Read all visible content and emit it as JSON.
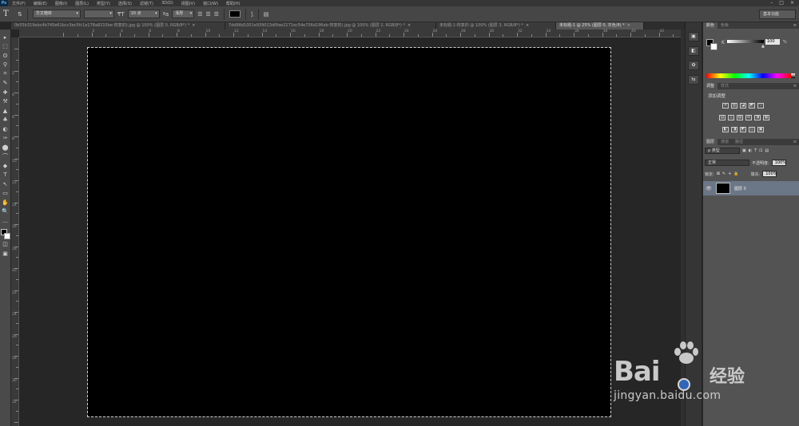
{
  "app": {
    "logo_text": "Ps"
  },
  "menu": [
    "文件(F)",
    "编辑(E)",
    "图像(I)",
    "图层(L)",
    "类型(Y)",
    "选择(S)",
    "滤镜(T)",
    "3D(D)",
    "视图(V)",
    "窗口(W)",
    "帮助(H)"
  ],
  "window_controls": [
    "–",
    "□",
    "×"
  ],
  "options": {
    "tool_glyph": "T",
    "font_family": "华文楷体",
    "font_style": "",
    "font_size": "10 点",
    "aa_glyph": "ªa",
    "antialias": "浑厚",
    "workspace": "基本功能"
  },
  "tabs": [
    {
      "label": "0b55b319ebc4b745e61bcc3ec5fc1e178a8215be-恢复的).jpg @ 100% (图层 0, RGB/8*) *",
      "active": false
    },
    {
      "label": "7dd98d1001e939013d0fee2171ec54e736d196eb-恢复的).jpg @ 100% (图层 2, RGB/8*) *",
      "active": false
    },
    {
      "label": "未标题-1-恢复的 @ 100% (图层 3, RGB/8*) *",
      "active": false
    },
    {
      "label": "未标题-1 @ 25% (图层 0, 灰色/8) *",
      "active": true
    }
  ],
  "tab_close": "×",
  "ruler": {
    "h_labels": [
      "2",
      "4",
      "6",
      "8",
      "10",
      "12",
      "14",
      "16",
      "18",
      "20",
      "22",
      "24",
      "26",
      "28",
      "30",
      "32",
      "34",
      "36",
      "38",
      "40",
      "42",
      "44",
      "46"
    ],
    "v_labels": [
      "2",
      "4",
      "6",
      "8",
      "10",
      "12",
      "14",
      "16",
      "18",
      "20",
      "22",
      "24",
      "26",
      "28",
      "30",
      "32",
      "34"
    ]
  },
  "tools": [
    "▸",
    "⬚",
    "ʘ",
    "⚲",
    "⌗",
    "✎",
    "✚",
    "⚒",
    "▲",
    "♣",
    "◐",
    "✑",
    "⬤",
    "⌒",
    "◆",
    "T",
    "↖",
    "▭",
    "✋",
    "🔍"
  ],
  "color_panel": {
    "tabs": [
      "颜色",
      "色板"
    ],
    "k_label": "K",
    "k_value": "100",
    "pct": "%",
    "menu_glyph": "≡"
  },
  "adjust_panel": {
    "tabs": [
      "调整",
      "样式"
    ],
    "title": "添加调整",
    "row1": [
      "☀",
      "▥",
      "◪",
      "◩",
      "▽"
    ],
    "row2": [
      "▤",
      "◬",
      "▧",
      "⚖",
      "◑",
      "▦"
    ],
    "row3": [
      "◧",
      "◨",
      "◩",
      "◫",
      "▣"
    ]
  },
  "layers_panel": {
    "tabs": [
      "图层",
      "通道",
      "路径"
    ],
    "filter_kind": "ρ 类型",
    "filter_icons": [
      "▣",
      "◐",
      "T",
      "⊡",
      "▤"
    ],
    "blend_mode": "正常",
    "opacity_label": "不透明度:",
    "opacity_value": "100%",
    "lock_label": "锁定:",
    "lock_icons": [
      "⊠",
      "✎",
      "✛",
      "🔒"
    ],
    "fill_label": "填充:",
    "fill_value": "100%",
    "layer": {
      "name": "图层 0",
      "visible_glyph": "👁"
    }
  },
  "iconstrip": [
    "▣",
    "◧",
    "✿",
    "⇆"
  ],
  "watermark": {
    "brand": "Bai",
    "brand2": "经验",
    "url": "jingyan.baidu.com"
  }
}
